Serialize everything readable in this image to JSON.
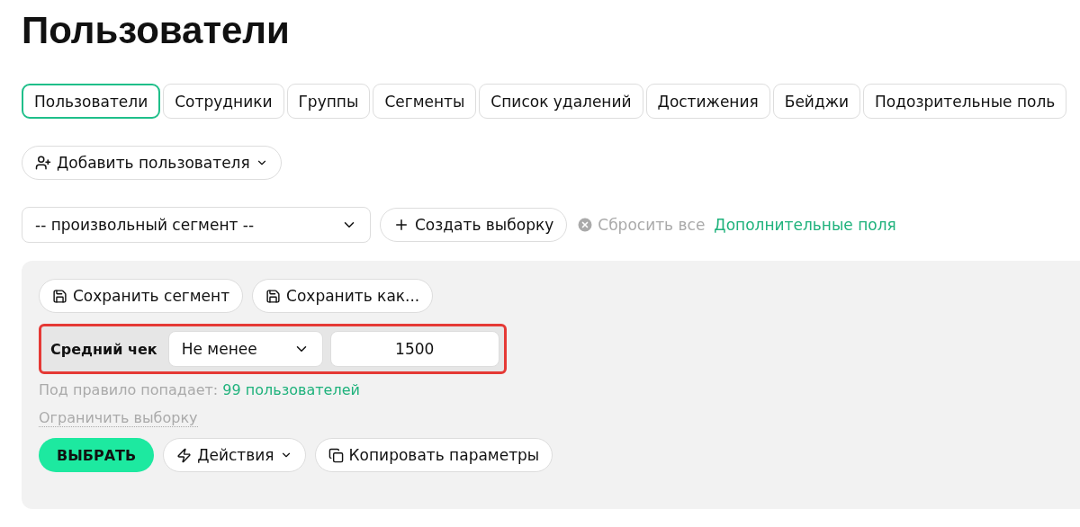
{
  "title": "Пользователи",
  "tabs": [
    {
      "label": "Пользователи",
      "selected": true
    },
    {
      "label": "Сотрудники",
      "selected": false
    },
    {
      "label": "Группы",
      "selected": false
    },
    {
      "label": "Сегменты",
      "selected": false
    },
    {
      "label": "Список удалений",
      "selected": false
    },
    {
      "label": "Достижения",
      "selected": false
    },
    {
      "label": "Бейджи",
      "selected": false
    },
    {
      "label": "Подозрительные поль",
      "selected": false
    }
  ],
  "add_user_button": {
    "label": "Добавить пользователя"
  },
  "filter_bar": {
    "segment_select": {
      "value": "-- произвольный сегмент --"
    },
    "create_button": {
      "label": "Создать выборку"
    },
    "reset": {
      "label": "Сбросить все"
    },
    "extra_fields_link": {
      "label": "Дополнительные поля"
    }
  },
  "panel": {
    "save_buttons": [
      {
        "label": "Сохранить сегмент"
      },
      {
        "label": "Сохранить как..."
      }
    ],
    "rule": {
      "label": "Средний чек",
      "operator": "Не менее",
      "value": "1500",
      "highlighted": true
    },
    "match_text": "Под правило попадает:",
    "match_link": "99 пользователей",
    "limit_link": "Ограничить выборку",
    "select_button": {
      "label": "ВЫБРАТЬ"
    },
    "actions_button": {
      "label": "Действия"
    },
    "copy_button": {
      "label": "Копировать параметры"
    }
  }
}
